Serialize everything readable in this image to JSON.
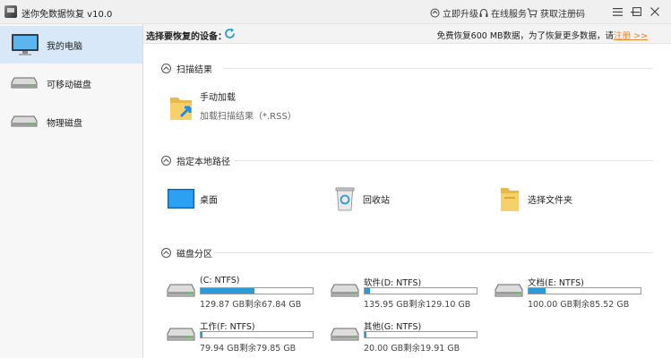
{
  "window": {
    "title": "迷你免数据恢复 v10.0",
    "upgrade_label": "立即升级",
    "service_label": "在线服务",
    "register_label": "获取注册码"
  },
  "sidebar": {
    "items": [
      {
        "label": "我的电脑",
        "icon": "monitor-icon",
        "active": true
      },
      {
        "label": "可移动磁盘",
        "icon": "removable-disk-icon",
        "active": false
      },
      {
        "label": "物理磁盘",
        "icon": "physical-disk-icon",
        "active": false
      }
    ]
  },
  "header": {
    "label": "选择要恢复的设备：",
    "promo_text": "免费恢复600 MB数据，为了恢复更多数据，请",
    "promo_link": "注册 >>"
  },
  "sections": {
    "scan_results": {
      "title": "扫描结果",
      "item": {
        "label": "手动加载",
        "sub": "加载扫描结果（*.RSS）"
      }
    },
    "paths": {
      "title": "指定本地路径",
      "items": [
        {
          "label": "桌面",
          "icon": "desktop-icon"
        },
        {
          "label": "回收站",
          "icon": "recycle-bin-icon"
        },
        {
          "label": "选择文件夹",
          "icon": "folder-icon"
        }
      ]
    },
    "partitions": {
      "title": "磁盘分区",
      "drives": [
        {
          "name": "(C: NTFS)",
          "size": "129.87 GB剩余67.84 GB",
          "used": 0.48
        },
        {
          "name": "软件(D: NTFS)",
          "size": "135.95 GB剩余129.10 GB",
          "used": 0.05
        },
        {
          "name": "文档(E: NTFS)",
          "size": "100.00 GB剩余85.52 GB",
          "used": 0.15
        },
        {
          "name": "工作(F: NTFS)",
          "size": "79.94 GB剩余79.85 GB",
          "used": 0.002
        },
        {
          "name": "其他(G: NTFS)",
          "size": "20.00 GB剩余19.91 GB",
          "used": 0.005
        }
      ]
    }
  },
  "colors": {
    "accent": "#2c9ad9",
    "link": "#e8862a",
    "sidebar_active": "#d8e8f8"
  }
}
